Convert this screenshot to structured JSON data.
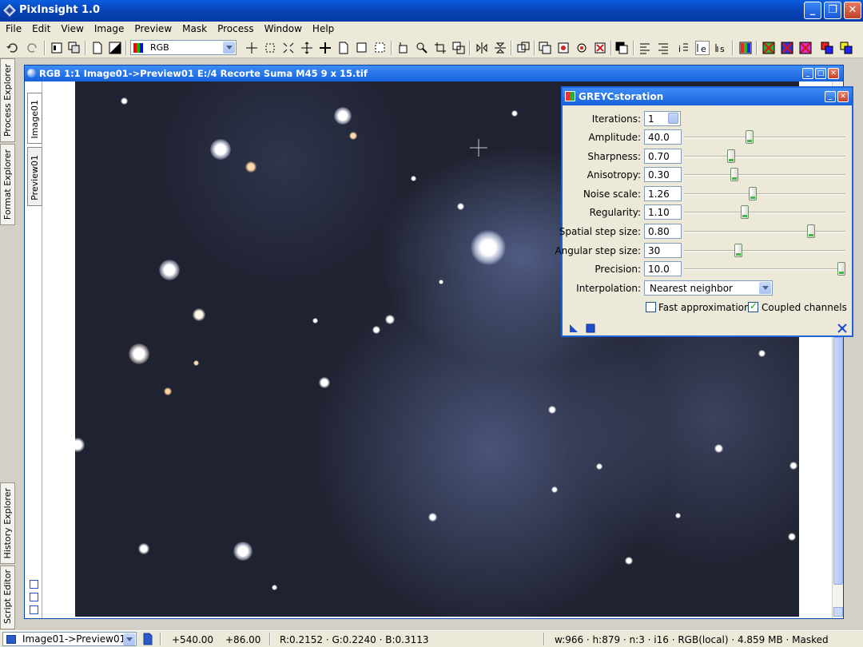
{
  "app": {
    "title": "PixInsight 1.0"
  },
  "menu": [
    "File",
    "Edit",
    "View",
    "Image",
    "Preview",
    "Mask",
    "Process",
    "Window",
    "Help"
  ],
  "toolbar": {
    "color_space": "RGB"
  },
  "side_tabs": [
    "Process Explorer",
    "Format Explorer",
    "History Explorer",
    "Script Editor"
  ],
  "image_window": {
    "title": "RGB 1:1 Image01->Preview01 E:/4 Recorte Suma M45 9 x 15.tif",
    "tabs": [
      "Image01",
      "Preview01"
    ]
  },
  "dialog": {
    "title": "GREYCstoration",
    "iterations_label": "Iterations:",
    "iterations_value": "1",
    "params": [
      {
        "label": "Amplitude:",
        "value": "40.0",
        "level": 0.4
      },
      {
        "label": "Sharpness:",
        "value": "0.70",
        "level": 0.28
      },
      {
        "label": "Anisotropy:",
        "value": "0.30",
        "level": 0.3
      },
      {
        "label": "Noise scale:",
        "value": "1.26",
        "level": 0.42
      },
      {
        "label": "Regularity:",
        "value": "1.10",
        "level": 0.37
      },
      {
        "label": "Spatial step size:",
        "value": "0.80",
        "level": 0.8
      },
      {
        "label": "Angular step size:",
        "value": "30",
        "level": 0.33
      },
      {
        "label": "Precision:",
        "value": "10.0",
        "level": 1.0
      }
    ],
    "interpolation_label": "Interpolation:",
    "interpolation_value": "Nearest neighbor",
    "fast_approx_label": "Fast approximation",
    "fast_approx_checked": false,
    "coupled_label": "Coupled channels",
    "coupled_checked": true
  },
  "status": {
    "view": "Image01->Preview01",
    "x": "+540.00",
    "y": "+86.00",
    "rgb": "R:0.2152 · G:0.2240 · B:0.3113",
    "info": "w:966 · h:879 · n:3 · i16 · RGB(local) · 4.859 MB · Masked"
  }
}
